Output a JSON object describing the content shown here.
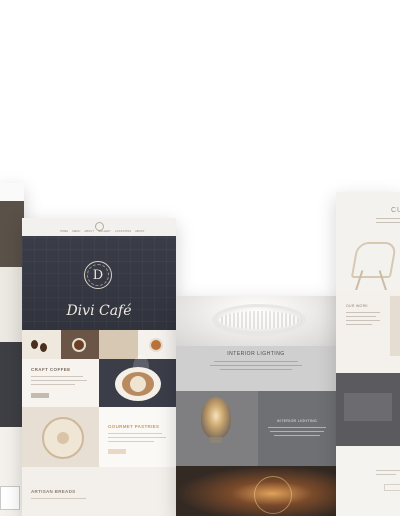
{
  "cafe": {
    "nav_items": [
      "HOME",
      "MENU",
      "ABOUT",
      "GALLERY",
      "LOCATIONS",
      "ABOUT"
    ],
    "emblem_letter": "D",
    "hero_title": "Divi Café",
    "section_craft_title": "CRAFT COFFEE",
    "section_pastries_title": "GOURMET PASTRIES",
    "section_artisan_title": "ARTISAN BREADS"
  },
  "lighting": {
    "title": "INTERIOR LIGHTING",
    "panel_title": "INTERIOR LIGHTING"
  },
  "furniture": {
    "heading": "CU",
    "our_work": "OUR WORK"
  }
}
